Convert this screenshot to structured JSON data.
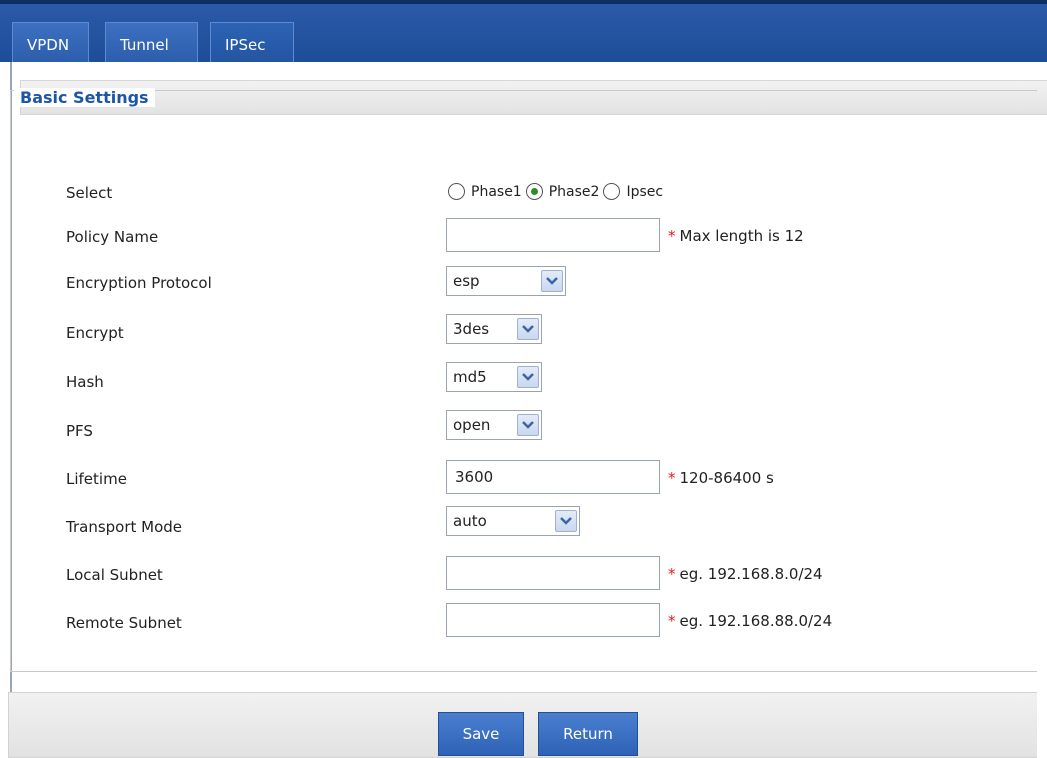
{
  "tabs": [
    {
      "label": "VPDN",
      "active": false
    },
    {
      "label": "Tunnel",
      "active": false
    },
    {
      "label": "IPSec",
      "active": true
    }
  ],
  "section": {
    "title": "Basic Settings"
  },
  "form": {
    "select": {
      "label": "Select",
      "options": [
        "Phase1",
        "Phase2",
        "Ipsec"
      ],
      "selected": "Phase2"
    },
    "policy_name": {
      "label": "Policy Name",
      "value": "",
      "note": "Max length is 12"
    },
    "encryption_protocol": {
      "label": "Encryption Protocol",
      "value": "esp"
    },
    "encrypt": {
      "label": "Encrypt",
      "value": "3des"
    },
    "hash": {
      "label": "Hash",
      "value": "md5"
    },
    "pfs": {
      "label": "PFS",
      "value": "open"
    },
    "lifetime": {
      "label": "Lifetime",
      "value": "3600",
      "note": "120-86400 s"
    },
    "transport_mode": {
      "label": "Transport Mode",
      "value": "auto"
    },
    "local_subnet": {
      "label": "Local Subnet",
      "value": "",
      "note": "eg. 192.168.8.0/24"
    },
    "remote_subnet": {
      "label": "Remote Subnet",
      "value": "",
      "note": "eg. 192.168.88.0/24"
    }
  },
  "required_marker": "*",
  "buttons": {
    "save": "Save",
    "return": "Return"
  },
  "colors": {
    "accent": "#1d55a8",
    "tab_bar": "#1e4d98",
    "required": "#e01c1c",
    "radio_dot": "#2e8b2e"
  },
  "icons": {
    "select_arrow": "chevron-down-icon"
  }
}
